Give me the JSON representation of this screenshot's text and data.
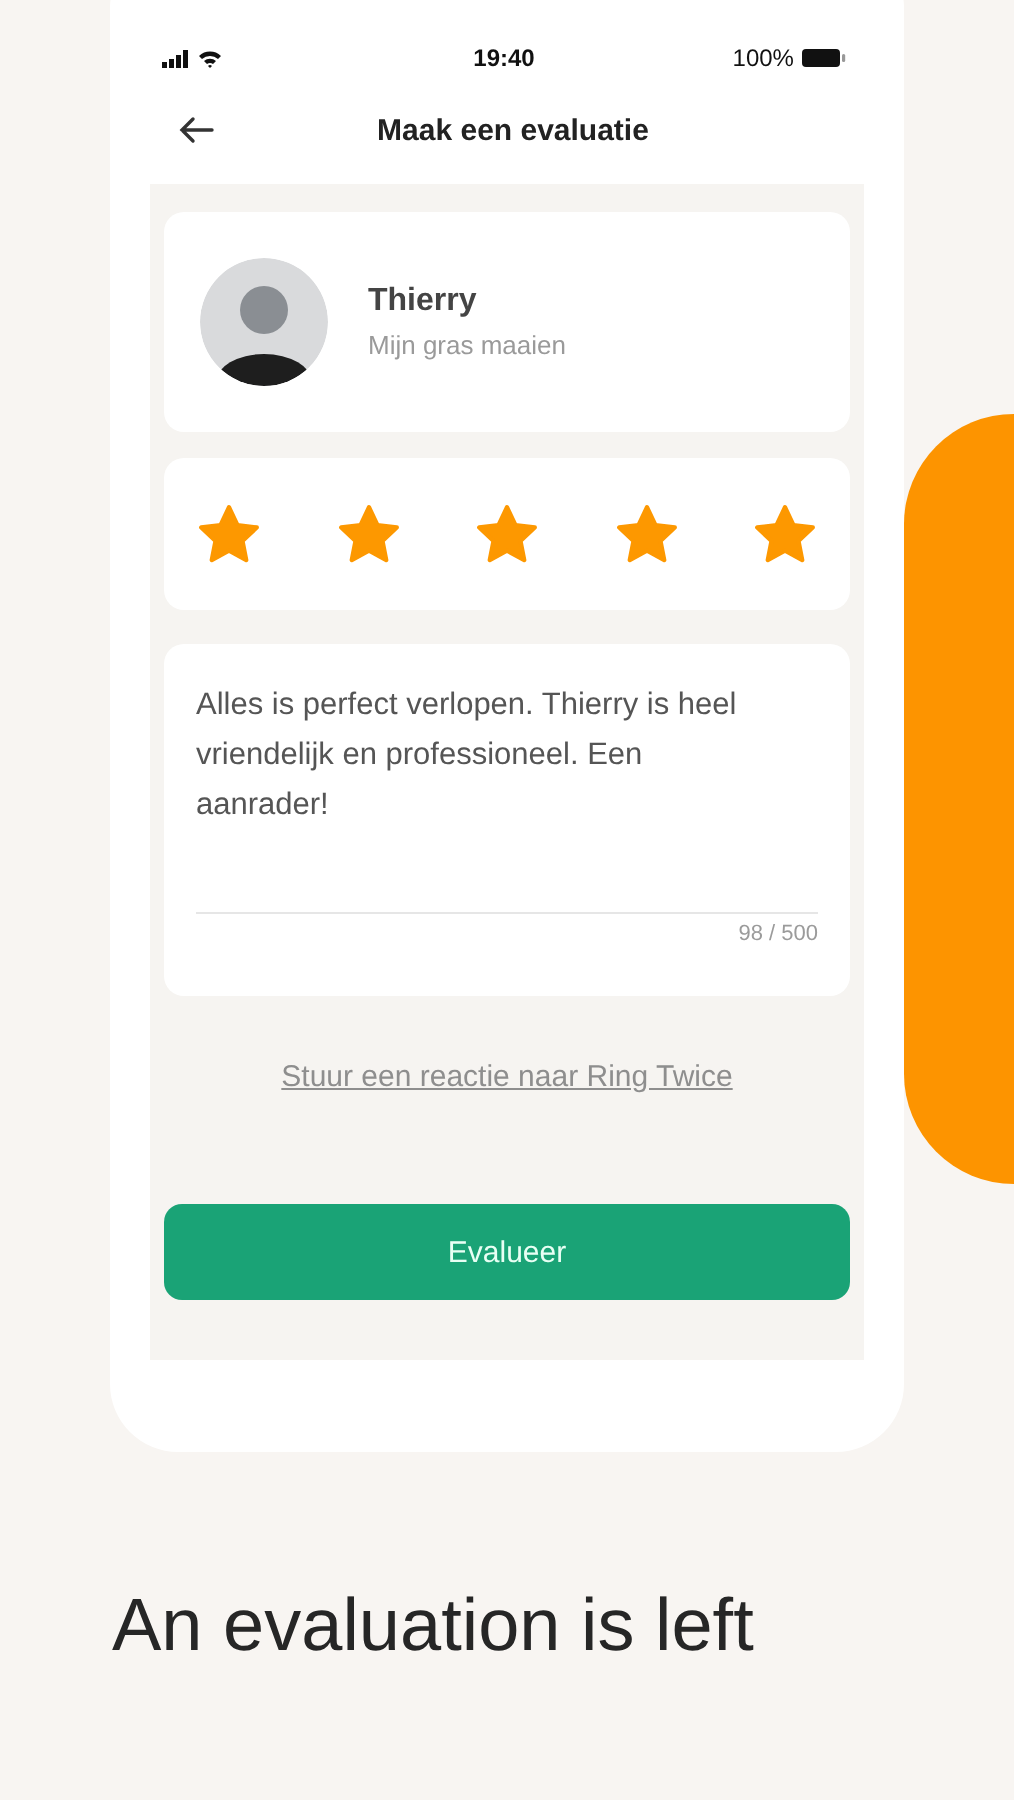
{
  "status_bar": {
    "time": "19:40",
    "battery": "100%"
  },
  "header": {
    "title": "Maak een evaluatie"
  },
  "provider": {
    "name": "Thierry",
    "task": "Mijn gras maaien"
  },
  "rating": {
    "stars": 5
  },
  "review": {
    "value": "Alles is perfect verlopen. Thierry is heel vriendelijk en professioneel. Een aanrader!",
    "counter": "98 / 500"
  },
  "feedback_link": "Stuur een reactie naar Ring Twice",
  "submit_button": "Evalueer",
  "caption": "An evaluation is left"
}
